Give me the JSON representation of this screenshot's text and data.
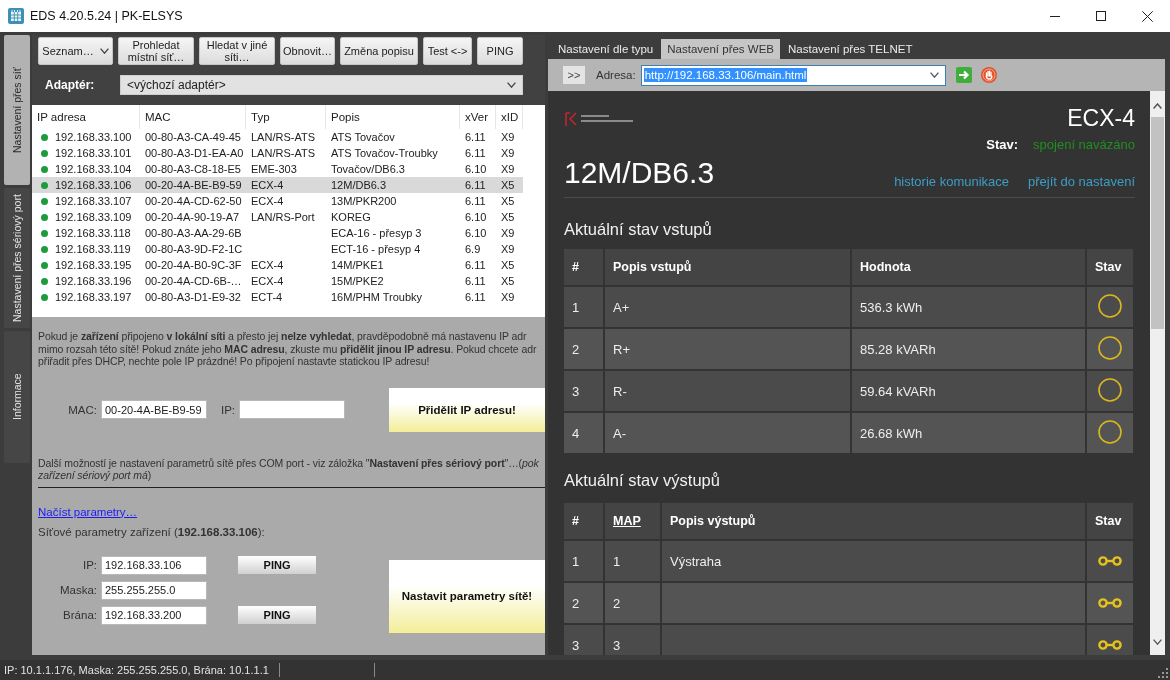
{
  "window": {
    "title": "EDS 4.20.5.24 | PK-ELSYS"
  },
  "side_tabs": [
    {
      "label": "Nastavení přes síť",
      "selected": true
    },
    {
      "label": "Nastavení přes sériový port",
      "selected": false
    },
    {
      "label": "Informace",
      "selected": false
    }
  ],
  "toolbar": [
    {
      "label": "Seznam…",
      "kind": "dropdown"
    },
    {
      "label": "Prohledat místní síť…",
      "kind": "button"
    },
    {
      "label": "Hledat v jiné síti…",
      "kind": "button"
    },
    {
      "label": "Obnovit…",
      "kind": "button"
    },
    {
      "label": "Změna popisu",
      "kind": "button"
    },
    {
      "label": "Test <->",
      "kind": "button"
    },
    {
      "label": "PING",
      "kind": "button"
    }
  ],
  "adapter": {
    "label": "Adaptér:",
    "value": "<výchozí adaptér>"
  },
  "device_table": {
    "columns": [
      "IP adresa",
      "MAC",
      "Typ",
      "Popis",
      "xVer",
      "xID"
    ],
    "rows": [
      {
        "ip": "192.168.33.100",
        "mac": "00-80-A3-CA-49-45",
        "type": "LAN/RS-ATS",
        "description": "ATS Tovačov",
        "xver": "6.11",
        "xid": "X9",
        "online": true,
        "selected": false
      },
      {
        "ip": "192.168.33.101",
        "mac": "00-80-A3-D1-EA-A0",
        "type": "LAN/RS-ATS",
        "description": "ATS Tovačov-Troubky",
        "xver": "6.11",
        "xid": "X9",
        "online": true,
        "selected": false
      },
      {
        "ip": "192.168.33.104",
        "mac": "00-80-A3-C8-18-E5",
        "type": "EME-303",
        "description": "Tovačov/DB6.3",
        "xver": "6.10",
        "xid": "X9",
        "online": true,
        "selected": false
      },
      {
        "ip": "192.168.33.106",
        "mac": "00-20-4A-BE-B9-59",
        "type": "ECX-4",
        "description": "12M/DB6.3",
        "xver": "6.11",
        "xid": "X5",
        "online": true,
        "selected": true
      },
      {
        "ip": "192.168.33.107",
        "mac": "00-20-4A-CD-62-50",
        "type": "ECX-4",
        "description": "13M/PKR200",
        "xver": "6.11",
        "xid": "X5",
        "online": true,
        "selected": false
      },
      {
        "ip": "192.168.33.109",
        "mac": "00-20-4A-90-19-A7",
        "type": "LAN/RS-Port",
        "description": "KOREG",
        "xver": "6.10",
        "xid": "X5",
        "online": true,
        "selected": false
      },
      {
        "ip": "192.168.33.118",
        "mac": "00-80-A3-AA-29-6B",
        "description": "ECA-16 - přesyp 3",
        "xver": "6.10",
        "xid": "X9",
        "online": true,
        "selected": false
      },
      {
        "ip": "192.168.33.119",
        "mac": "00-80-A3-9D-F2-1C",
        "description": "ECT-16 - přesyp 4",
        "xver": "6.9",
        "xid": "X9",
        "online": true,
        "selected": false
      },
      {
        "ip": "192.168.33.195",
        "mac": "00-20-4A-B0-9C-3F",
        "type": "ECX-4",
        "description": "14M/PKE1",
        "xver": "6.11",
        "xid": "X5",
        "online": true,
        "selected": false
      },
      {
        "ip": "192.168.33.196",
        "mac": "00-20-4A-CD-6B-…",
        "type": "ECX-4",
        "description": "15M/PKE2",
        "xver": "6.11",
        "xid": "X5",
        "online": true,
        "selected": false
      },
      {
        "ip": "192.168.33.197",
        "mac": "00-80-A3-D1-E9-32",
        "type": "ECT-4",
        "description": "16M/PHM Troubky",
        "xver": "6.11",
        "xid": "X9",
        "online": true,
        "selected": false
      }
    ]
  },
  "info_text": "Pokud je **zařízení** připojeno **v lokální síti** a přesto jej **nelze vyhledat**, pravděpodobně má nastavenu IP adr\nmimo rozsah této sítě! Pokud znáte jeho **MAC adresu**, zkuste mu **přidělit jinou IP adresu**. Pokud chcete adr\npřiřadit přes DHCP, nechte pole IP prázdné! Po připojení nastavte statickou IP adresu!",
  "assign_form": {
    "mac_label": "MAC:",
    "mac_value": "00-20-4A-BE-B9-59",
    "ip_label": "IP:",
    "button": "Přidělit IP adresu!"
  },
  "com_port_text": "Další možností je nastavení parametrů sítě přes COM port - viz záložka \"**Nastavení přes sériový port**\"…(*pok*\n*zařízení sériový port má*)",
  "load_link": "Načíst parametry…",
  "params_heading": "Síťové parametry zařízení (**192.168.33.106**):",
  "params": {
    "fields": [
      {
        "label": "IP:",
        "value": "192.168.33.106",
        "ping": "PING"
      },
      {
        "label": "Maska:",
        "value": "255.255.255.0"
      },
      {
        "label": "Brána:",
        "value": "192.168.33.200",
        "ping": "PING"
      }
    ],
    "button": "Nastavit parametry sítě!"
  },
  "web_tabs": [
    {
      "label": "Nastavení dle typu",
      "selected": false
    },
    {
      "label": "Nastavení přes WEB",
      "selected": true
    },
    {
      "label": "Nastavení přes TELNET",
      "selected": false
    }
  ],
  "address_bar": {
    "button": ">>",
    "label": "Adresa:",
    "value": "http://192.168.33.106/main.html",
    "text_selected": true
  },
  "web_page": {
    "device_type": "ECX-4",
    "status_label": "Stav:",
    "status_value": "spojení navázáno",
    "device_name": "12M/DB6.3",
    "links": [
      "historie komunikace",
      "přejít do nastavení"
    ],
    "inputs": {
      "title": "Aktuální stav vstupů",
      "columns": [
        "#",
        "Popis vstupů",
        "Hodnota",
        "Stav"
      ],
      "rows": [
        {
          "number": "1",
          "name": "A+",
          "value": "536.3 kWh",
          "on": false
        },
        {
          "number": "2",
          "name": "R+",
          "value": "85.28 kVARh",
          "on": false
        },
        {
          "number": "3",
          "name": "R-",
          "value": "59.64 kVARh",
          "on": false
        },
        {
          "number": "4",
          "name": "A-",
          "value": "26.68 kWh",
          "on": false
        }
      ]
    },
    "outputs": {
      "title": "Aktuální stav výstupů",
      "columns": [
        {
          "label": "#",
          "kind": "text"
        },
        {
          "label": "MAP",
          "kind": "link"
        },
        {
          "label": "Popis výstupů",
          "kind": "text"
        },
        {
          "label": "Stav",
          "kind": "text"
        }
      ],
      "rows": [
        {
          "number": "1",
          "map": "1",
          "name": "Výstraha"
        },
        {
          "number": "2",
          "map": "2"
        },
        {
          "number": "3",
          "map": "3"
        }
      ]
    }
  },
  "status_bar": {
    "text": "IP: 10.1.1.176, Maska: 255.255.255.0, Brána: 10.1.1.1"
  }
}
